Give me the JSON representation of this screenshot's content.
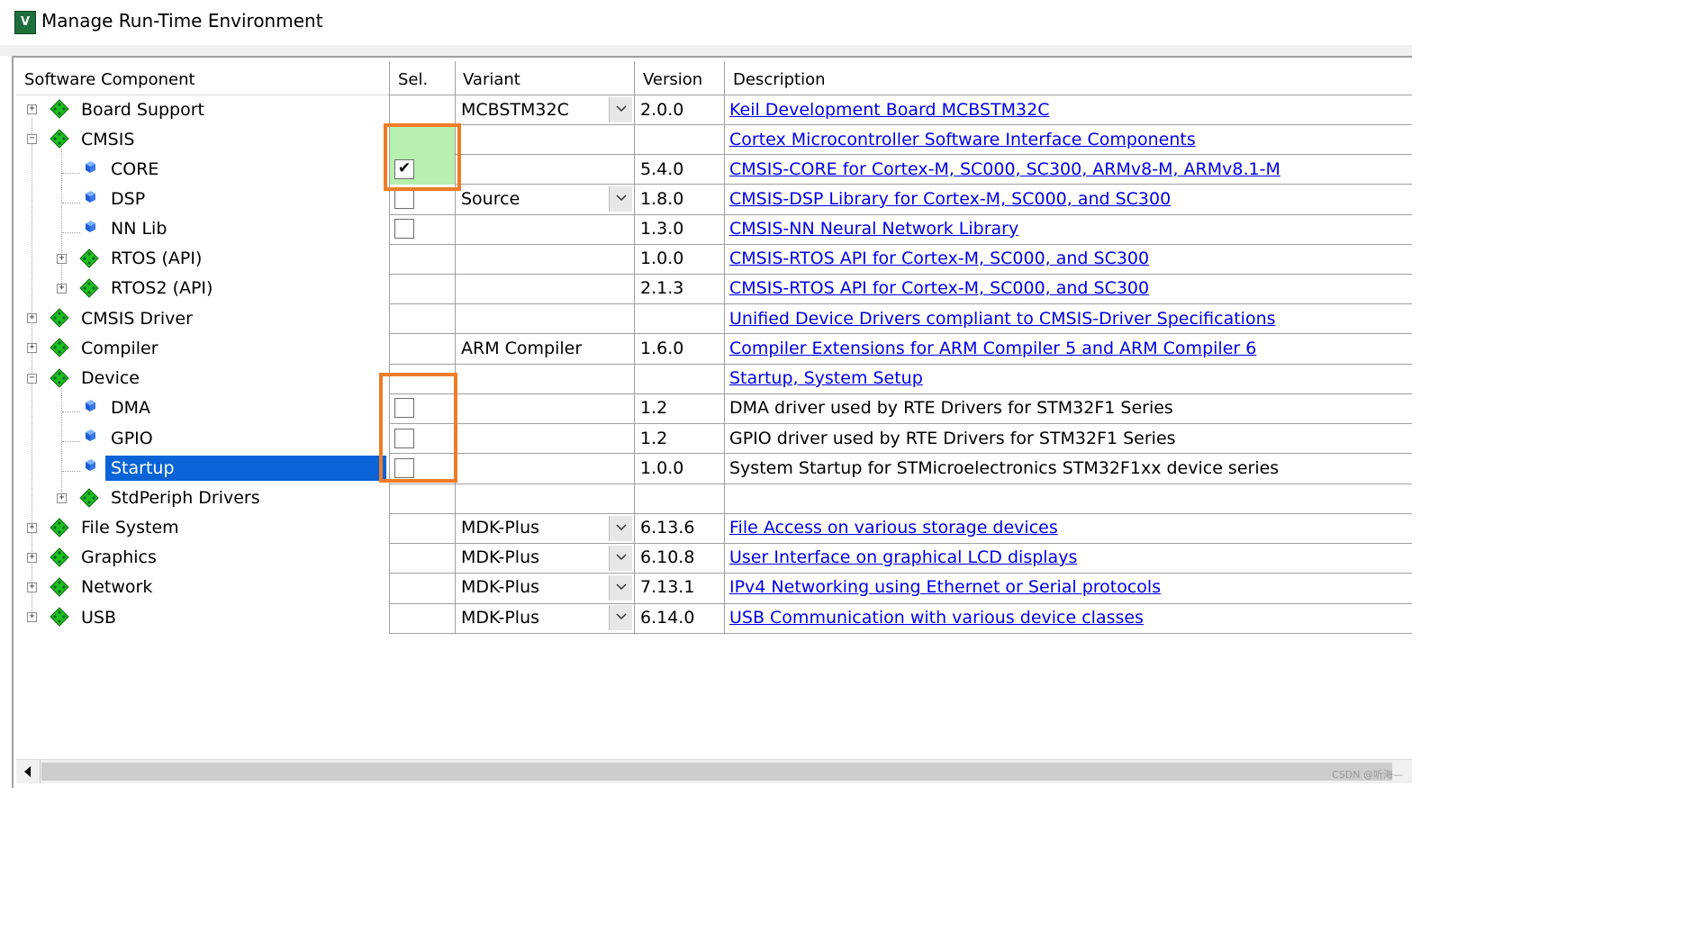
{
  "window": {
    "title": "Manage Run-Time Environment",
    "app_icon_text": "V"
  },
  "columns": {
    "component": "Software Component",
    "sel": "Sel.",
    "variant": "Variant",
    "version": "Version",
    "description": "Description"
  },
  "rows": [
    {
      "label": "Board Support",
      "expander": "+",
      "icon": "package-icon",
      "variant": "MCBSTM32C",
      "variant_dropdown": true,
      "version": "2.0.0",
      "description": "Keil Development Board MCBSTM32C",
      "description_link": true
    },
    {
      "label": "CMSIS",
      "expander": "−",
      "icon": "package-icon",
      "variant": "",
      "version": "",
      "description": "Cortex Microcontroller Software Interface Components",
      "description_link": true
    },
    {
      "label": "CORE",
      "icon": "component-icon",
      "checkbox": "checked",
      "variant": "",
      "version": "5.4.0",
      "description": "CMSIS-CORE for Cortex-M, SC000, SC300, ARMv8-M, ARMv8.1-M",
      "description_link": true
    },
    {
      "label": "DSP",
      "icon": "component-icon",
      "checkbox": "unchecked",
      "variant": "Source",
      "variant_dropdown": true,
      "version": "1.8.0",
      "description": "CMSIS-DSP Library for Cortex-M, SC000, and SC300",
      "description_link": true
    },
    {
      "label": "NN Lib",
      "icon": "component-icon",
      "checkbox": "unchecked",
      "variant": "",
      "version": "1.3.0",
      "description": "CMSIS-NN Neural Network Library",
      "description_link": true
    },
    {
      "label": "RTOS (API)",
      "expander": "+",
      "icon": "package-icon",
      "variant": "",
      "version": "1.0.0",
      "description": "CMSIS-RTOS API for Cortex-M, SC000, and SC300",
      "description_link": true
    },
    {
      "label": "RTOS2 (API)",
      "expander": "+",
      "icon": "package-icon",
      "variant": "",
      "version": "2.1.3",
      "description": "CMSIS-RTOS API for Cortex-M, SC000, and SC300",
      "description_link": true
    },
    {
      "label": "CMSIS Driver",
      "expander": "+",
      "icon": "package-icon",
      "variant": "",
      "version": "",
      "description": "Unified Device Drivers compliant to CMSIS-Driver Specifications",
      "description_link": true
    },
    {
      "label": "Compiler",
      "expander": "+",
      "icon": "package-icon",
      "variant": "ARM Compiler",
      "version": "1.6.0",
      "description": "Compiler Extensions for ARM Compiler 5 and ARM Compiler 6",
      "description_link": true
    },
    {
      "label": "Device",
      "expander": "−",
      "icon": "package-icon",
      "variant": "",
      "version": "",
      "description": "Startup, System Setup",
      "description_link": true
    },
    {
      "label": "DMA",
      "icon": "component-icon",
      "checkbox": "unchecked",
      "variant": "",
      "version": "1.2",
      "description": "DMA driver used by RTE Drivers for STM32F1 Series",
      "description_link": false
    },
    {
      "label": "GPIO",
      "icon": "component-icon",
      "checkbox": "unchecked",
      "variant": "",
      "version": "1.2",
      "description": "GPIO driver used by RTE Drivers for STM32F1 Series",
      "description_link": false
    },
    {
      "label": "Startup",
      "icon": "component-icon",
      "checkbox": "unchecked",
      "selected": true,
      "variant": "",
      "version": "1.0.0",
      "description": "System Startup for STMicroelectronics STM32F1xx device series",
      "description_link": false
    },
    {
      "label": "StdPeriph Drivers",
      "expander": "+",
      "icon": "package-icon",
      "variant": "",
      "version": "",
      "description": "",
      "description_link": false
    },
    {
      "label": "File System",
      "expander": "+",
      "icon": "package-icon",
      "variant": "MDK-Plus",
      "variant_dropdown": true,
      "version": "6.13.6",
      "description": "File Access on various storage devices",
      "description_link": true
    },
    {
      "label": "Graphics",
      "expander": "+",
      "icon": "package-icon",
      "variant": "MDK-Plus",
      "variant_dropdown": true,
      "version": "6.10.8",
      "description": "User Interface on graphical LCD displays",
      "description_link": true
    },
    {
      "label": "Network",
      "expander": "+",
      "icon": "package-icon",
      "variant": "MDK-Plus",
      "variant_dropdown": true,
      "version": "7.13.1",
      "description": "IPv4 Networking using Ethernet or Serial protocols",
      "description_link": true
    },
    {
      "label": "USB",
      "expander": "+",
      "icon": "package-icon",
      "variant": "MDK-Plus",
      "variant_dropdown": true,
      "version": "6.14.0",
      "description": "USB Communication with various device classes",
      "description_link": true
    }
  ],
  "colors": {
    "selection": "#0a64d7",
    "link": "#0000e6",
    "sel_highlight": "#b8f0b0",
    "annotation_box": "#f07c26",
    "package_icon": "#1fbf1f"
  },
  "watermark": "CSDN @听海—"
}
